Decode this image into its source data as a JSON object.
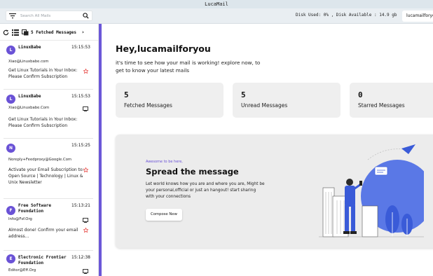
{
  "window": {
    "title": "LucaMail"
  },
  "search": {
    "placeholder": "Search All Mails"
  },
  "disk": {
    "text": "Disk Used: 0% , Disk Available : 14.9 gb"
  },
  "account": {
    "label": "lucamailforyou"
  },
  "sidebar": {
    "fetched_label": "5 Fetched Messages",
    "mails": [
      {
        "avatar": "L",
        "from": "LinuxBabe",
        "time": "15:15:53",
        "address": "Xiao@Linuxbabe.com",
        "subject": "Get Linux Tutorials in Your Inbox: Please Confirm Subscription",
        "starred": true
      },
      {
        "avatar": "L",
        "from": "LinuxBabe",
        "time": "15:15:53",
        "address": "Xiao@Linuxbabe.Com",
        "subject": "Get Linux Tutorials in Your Inbox: Please Confirm Subscription",
        "starred": false
      },
      {
        "avatar": "N",
        "from": "",
        "time": "15:15:25",
        "address": "Noreply+Feedproxy@Google.Com",
        "subject": "Activate your Email Subscription to: Open Source | Technology | Linux & Unix Newsletter",
        "starred": true
      },
      {
        "avatar": "F",
        "from": "Free Software Foundation",
        "time": "15:13:21",
        "address": "Info@Fsf.Org",
        "subject": "Almost done! Confirm your email address...",
        "starred": true
      },
      {
        "avatar": "E",
        "from": "Electronic Frontier Foundation",
        "time": "15:12:38",
        "address": "Editor@Eff.Org",
        "subject": "",
        "starred": false
      }
    ]
  },
  "main": {
    "greeting": "Hey,lucamailforyou",
    "intro": "it's time to see how your mail is working! explore now, to get to know your latest mails",
    "stats": [
      {
        "value": "5",
        "label": "Fetched Messages"
      },
      {
        "value": "5",
        "label": "Unread Messages"
      },
      {
        "value": "0",
        "label": "Starred Messages"
      }
    ],
    "banner": {
      "kicker": "Awesome to be here,",
      "heading": "Spread the message",
      "description": "Let world knows how you are and where you are, Might be your personal,official or just an hangout! start sharing with your connections",
      "button": "Compose New"
    }
  },
  "colors": {
    "accent": "#6b57d8",
    "star": "#e53935",
    "avatar": "#6a52d6"
  }
}
